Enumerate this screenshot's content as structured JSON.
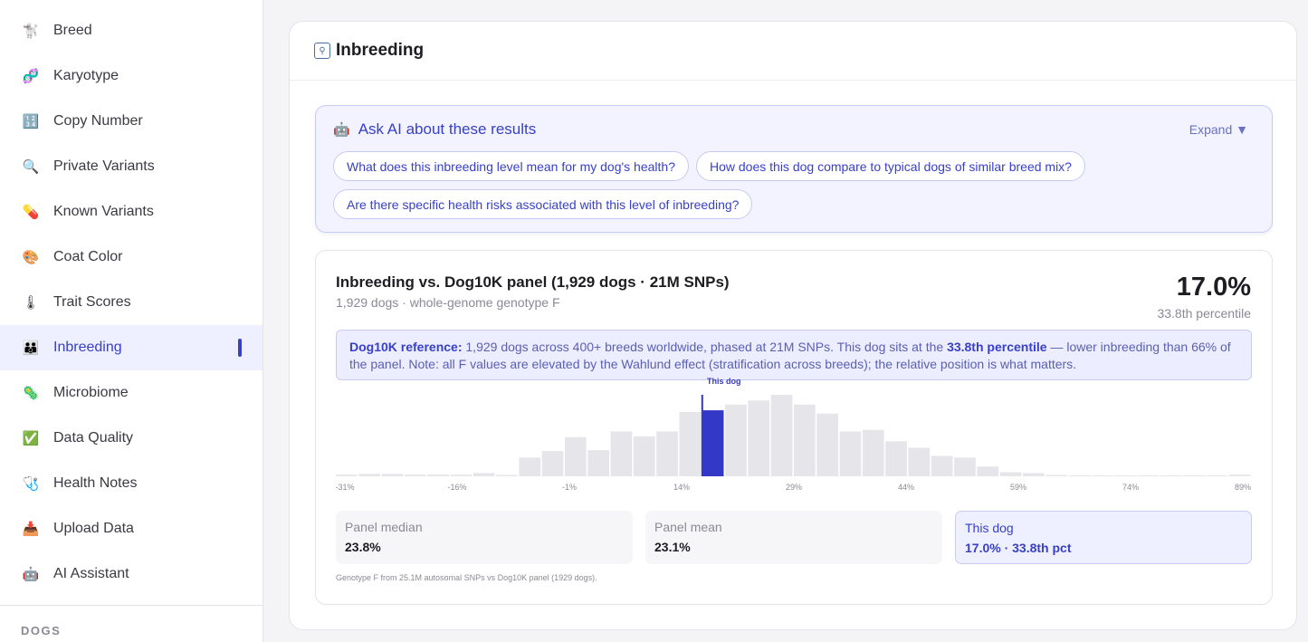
{
  "sidebar": {
    "items": [
      {
        "label": "Breed",
        "icon": "poodle-icon",
        "glyph": "🐩"
      },
      {
        "label": "Karyotype",
        "icon": "chromosome-icon",
        "glyph": "🧬"
      },
      {
        "label": "Copy Number",
        "icon": "numbers-icon",
        "glyph": "🔢"
      },
      {
        "label": "Private Variants",
        "icon": "magnifier-icon",
        "glyph": "🔍"
      },
      {
        "label": "Known Variants",
        "icon": "pill-icon",
        "glyph": "💊"
      },
      {
        "label": "Coat Color",
        "icon": "palette-icon",
        "glyph": "🎨"
      },
      {
        "label": "Trait Scores",
        "icon": "thermometer-icon",
        "glyph": "🌡"
      },
      {
        "label": "Inbreeding",
        "icon": "family-icon",
        "glyph": "👪"
      },
      {
        "label": "Microbiome",
        "icon": "microbe-icon",
        "glyph": "🦠"
      },
      {
        "label": "Data Quality",
        "icon": "check-mark-icon",
        "glyph": "✅"
      },
      {
        "label": "Health Notes",
        "icon": "stethoscope-icon",
        "glyph": "🩺"
      },
      {
        "label": "Upload Data",
        "icon": "inbox-icon",
        "glyph": "📥"
      },
      {
        "label": "AI Assistant",
        "icon": "robot-icon",
        "glyph": "🤖"
      }
    ],
    "active_index": 7,
    "section_label": "DOGS"
  },
  "card": {
    "title": "Inbreeding",
    "title_icon": "family-icon"
  },
  "ai": {
    "title": "Ask AI about these results",
    "icon": "robot-icon",
    "expand_label": "Expand ▼",
    "chips": [
      "What does this inbreeding level mean for my dog's health?",
      "How does this dog compare to typical dogs of similar breed mix?",
      "Are there specific health risks associated with this level of inbreeding?"
    ]
  },
  "panel": {
    "title": "Inbreeding vs. Dog10K panel (1,929 dogs · 21M SNPs)",
    "subtitle": "1,929 dogs · whole-genome genotype F",
    "big_value": "17.0%",
    "big_sub": "33.8th percentile",
    "note": {
      "lead": "Dog10K reference:",
      "text1": " 1,929 dogs across 400+ breeds worldwide, phased at 21M SNPs. This dog sits at the ",
      "strong": "33.8th percentile",
      "text2": " — lower inbreeding than 66% of the panel. Note: all F values are elevated by the Wahlund effect (stratification across breeds); the relative position is what matters."
    },
    "stats": [
      {
        "label": "Panel median",
        "value": "23.8%"
      },
      {
        "label": "Panel mean",
        "value": "23.1%"
      },
      {
        "label": "This dog",
        "value": "17.0% · 33.8th pct"
      }
    ],
    "footnote": "Genotype F from 25.1M autosomal SNPs vs Dog10K panel (1929 dogs)."
  },
  "chart_data": {
    "type": "bar",
    "x_ticks": [
      "-31%",
      "-16%",
      "-1%",
      "14%",
      "29%",
      "44%",
      "59%",
      "74%",
      "89%"
    ],
    "xlim": [
      -31,
      89
    ],
    "relative_heights": [
      2,
      3,
      3,
      2,
      2,
      2,
      4,
      1,
      23,
      31,
      48,
      32,
      55,
      49,
      55,
      79,
      81,
      88,
      93,
      100,
      88,
      77,
      55,
      57,
      43,
      35,
      25,
      23,
      12,
      5,
      4,
      1,
      0,
      0,
      0,
      0,
      0,
      0,
      0,
      2
    ],
    "highlight_index": 16,
    "marker_label": "This dog",
    "colors": {
      "bar": "#e6e6ea",
      "highlight": "#3438c6",
      "marker": "#3438c6"
    }
  }
}
